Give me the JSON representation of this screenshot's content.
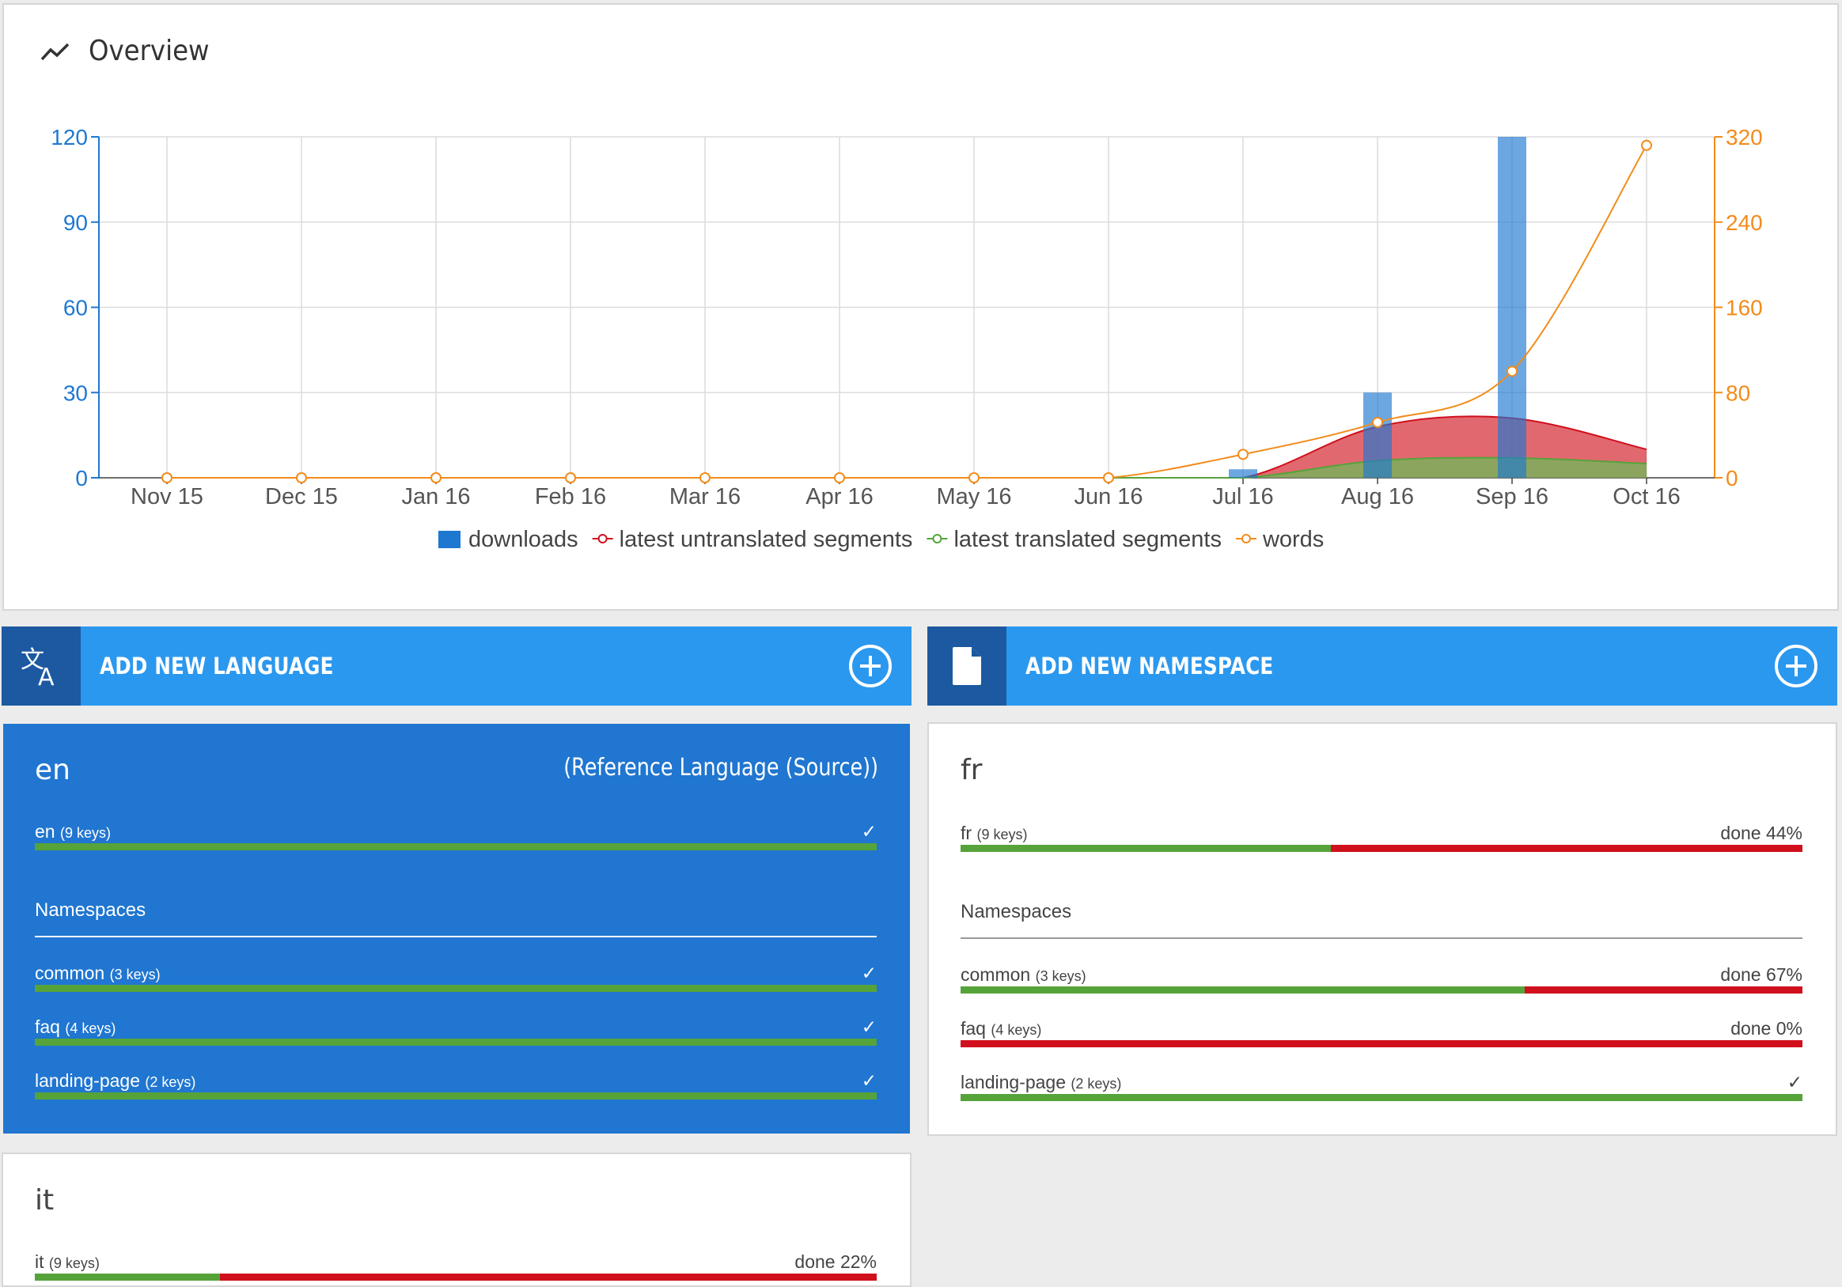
{
  "overview": {
    "title": "Overview",
    "icon": "trending-up-icon"
  },
  "chart_data": {
    "type": "bar",
    "categories": [
      "Nov 15",
      "Dec 15",
      "Jan 16",
      "Feb 16",
      "Mar 16",
      "Apr 16",
      "May 16",
      "Jun 16",
      "Jul 16",
      "Aug 16",
      "Sep 16",
      "Oct 16"
    ],
    "left_axis": {
      "ticks": [
        0,
        30,
        60,
        90,
        120
      ],
      "ylim": [
        0,
        120
      ],
      "color": "#1e78d1"
    },
    "right_axis": {
      "ticks": [
        0,
        80,
        160,
        240,
        320
      ],
      "ylim": [
        0,
        320
      ],
      "color": "#f28c1b"
    },
    "grid": true,
    "legend_position": "bottom-center",
    "series": [
      {
        "name": "downloads",
        "type": "bar",
        "axis": "left",
        "color": "#1e78d1",
        "values": [
          0,
          0,
          0,
          0,
          0,
          0,
          0,
          0,
          3,
          30,
          120,
          0
        ]
      },
      {
        "name": "latest untranslated segments",
        "type": "area",
        "axis": "left",
        "color": "#d0101c",
        "values": [
          0,
          0,
          0,
          0,
          0,
          0,
          0,
          0,
          0,
          18,
          21,
          10
        ]
      },
      {
        "name": "latest translated segments",
        "type": "area",
        "axis": "left",
        "color": "#56a33a",
        "values": [
          0,
          0,
          0,
          0,
          0,
          0,
          0,
          0,
          0,
          6,
          7,
          5
        ]
      },
      {
        "name": "words",
        "type": "line",
        "axis": "right",
        "color": "#f28c1b",
        "values": [
          0,
          0,
          0,
          0,
          0,
          0,
          0,
          0,
          22,
          52,
          100,
          312
        ]
      }
    ]
  },
  "add_language": {
    "label": "ADD NEW LANGUAGE",
    "icon": "translate-icon",
    "action_icon": "add-circle-icon"
  },
  "add_namespace": {
    "label": "ADD NEW NAMESPACE",
    "icon": "file-icon",
    "action_icon": "add-circle-icon"
  },
  "languages": [
    {
      "code": "en",
      "reference_label": "(Reference Language (Source))",
      "total": {
        "name": "en",
        "keys": "(9 keys)",
        "status": "✓",
        "done": 1.0
      },
      "namespaces_label": "Namespaces",
      "namespaces": [
        {
          "name": "common",
          "keys": "(3 keys)",
          "status": "✓",
          "done": 1.0
        },
        {
          "name": "faq",
          "keys": "(4 keys)",
          "status": "✓",
          "done": 1.0
        },
        {
          "name": "landing-page",
          "keys": "(2 keys)",
          "status": "✓",
          "done": 1.0
        }
      ]
    },
    {
      "code": "fr",
      "total": {
        "name": "fr",
        "keys": "(9 keys)",
        "status": "done 44%",
        "done": 0.44
      },
      "namespaces_label": "Namespaces",
      "namespaces": [
        {
          "name": "common",
          "keys": "(3 keys)",
          "status": "done 67%",
          "done": 0.67
        },
        {
          "name": "faq",
          "keys": "(4 keys)",
          "status": "done 0%",
          "done": 0.0
        },
        {
          "name": "landing-page",
          "keys": "(2 keys)",
          "status": "✓",
          "done": 1.0
        }
      ]
    },
    {
      "code": "it",
      "total": {
        "name": "it",
        "keys": "(9 keys)",
        "status": "done 22%",
        "done": 0.22
      }
    }
  ]
}
